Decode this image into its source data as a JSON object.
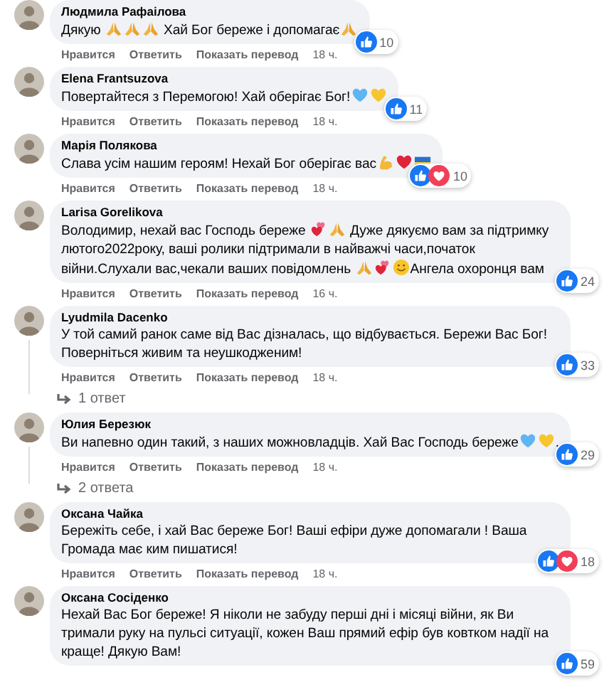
{
  "comments": [
    {
      "author": "Людмила Рафаілова",
      "body": [
        {
          "kind": "text",
          "text": "Дякую "
        },
        {
          "kind": "pray"
        },
        {
          "kind": "pray"
        },
        {
          "kind": "pray"
        },
        {
          "kind": "text",
          "text": " Хай Бог береже і допомагає"
        },
        {
          "kind": "pray"
        }
      ],
      "reactions": [
        {
          "kind": "like"
        }
      ],
      "reaction_count": "10",
      "actions": [
        "Нравится",
        "Ответить",
        "Показать перевод"
      ],
      "time": "18 ч."
    },
    {
      "author": "Elena Frantsuzova",
      "body": [
        {
          "kind": "text",
          "text": "Повертайтеся з Перемогою! Хай оберігає Бог!"
        },
        {
          "kind": "blue-heart"
        },
        {
          "kind": "yellow-heart"
        }
      ],
      "reactions": [
        {
          "kind": "like"
        }
      ],
      "reaction_count": "11",
      "actions": [
        "Нравится",
        "Ответить",
        "Показать перевод"
      ],
      "time": "18 ч."
    },
    {
      "author": "Марія Полякова",
      "body": [
        {
          "kind": "text",
          "text": "Слава усім нашим героям! Нехай Бог оберігає вас"
        },
        {
          "kind": "muscle"
        },
        {
          "kind": "red-heart"
        },
        {
          "kind": "flag"
        }
      ],
      "reactions": [
        {
          "kind": "like"
        },
        {
          "kind": "love"
        }
      ],
      "reaction_count": "10",
      "actions": [
        "Нравится",
        "Ответить",
        "Показать перевод"
      ],
      "time": "18 ч."
    },
    {
      "author": "Larisa Gorelikova",
      "body": [
        {
          "kind": "text",
          "text": "Володимир, нехай вас Господь береже "
        },
        {
          "kind": "two-hearts"
        },
        {
          "kind": "pray"
        },
        {
          "kind": "text",
          "text": " Дуже дякуємо вам за підтримку лютого2022року, ваші ролики підтримали в найважчі часи,початок війни.Слухали вас,чекали ваших повідомлень "
        },
        {
          "kind": "pray"
        },
        {
          "kind": "two-hearts"
        },
        {
          "kind": "smile"
        },
        {
          "kind": "text",
          "text": "Ангела охоронця вам"
        }
      ],
      "reactions": [
        {
          "kind": "like"
        }
      ],
      "reaction_count": "24",
      "actions": [
        "Нравится",
        "Ответить",
        "Показать перевод"
      ],
      "time": "16 ч."
    },
    {
      "author": "Lyudmila Dacenko",
      "body": [
        {
          "kind": "text",
          "text": "У той самий ранок саме від Вас дізналась, що відбувається. Бережи Вас Бог! Поверніться живим та неушкодженим!"
        }
      ],
      "reactions": [
        {
          "kind": "like"
        }
      ],
      "reaction_count": "33",
      "actions": [
        "Нравится",
        "Ответить",
        "Показать перевод"
      ],
      "time": "18 ч.",
      "replies": "1 ответ"
    },
    {
      "author": "Юлия Березюк",
      "body": [
        {
          "kind": "text",
          "text": "Ви напевно один такий, з наших можновладців. Хай Вас Господь береже"
        },
        {
          "kind": "blue-heart"
        },
        {
          "kind": "yellow-heart"
        },
        {
          "kind": "text",
          "text": "."
        }
      ],
      "reactions": [
        {
          "kind": "like"
        }
      ],
      "reaction_count": "29",
      "actions": [
        "Нравится",
        "Ответить",
        "Показать перевод"
      ],
      "time": "18 ч.",
      "replies": "2 ответа"
    },
    {
      "author": "Оксана Чайка",
      "body": [
        {
          "kind": "text",
          "text": "Бережіть себе, і хай Вас береже Бог! Ваші ефіри дуже допомагали ! Ваша Громада має ким пишатися!"
        }
      ],
      "reactions": [
        {
          "kind": "like"
        },
        {
          "kind": "love"
        }
      ],
      "reaction_count": "18",
      "actions": [
        "Нравится",
        "Ответить",
        "Показать перевод"
      ],
      "time": "18 ч."
    },
    {
      "author": "Оксана Сосіденко",
      "body": [
        {
          "kind": "text",
          "text": "Нехай Вас Бог береже! Я ніколи не забуду перші дні і місяці війни, як Ви тримали руку на пульсі ситуації, кожен Ваш прямий ефір був ковтком надії на краще! Дякую Вам!"
        }
      ],
      "reactions": [
        {
          "kind": "like"
        }
      ],
      "reaction_count": "59"
    }
  ]
}
